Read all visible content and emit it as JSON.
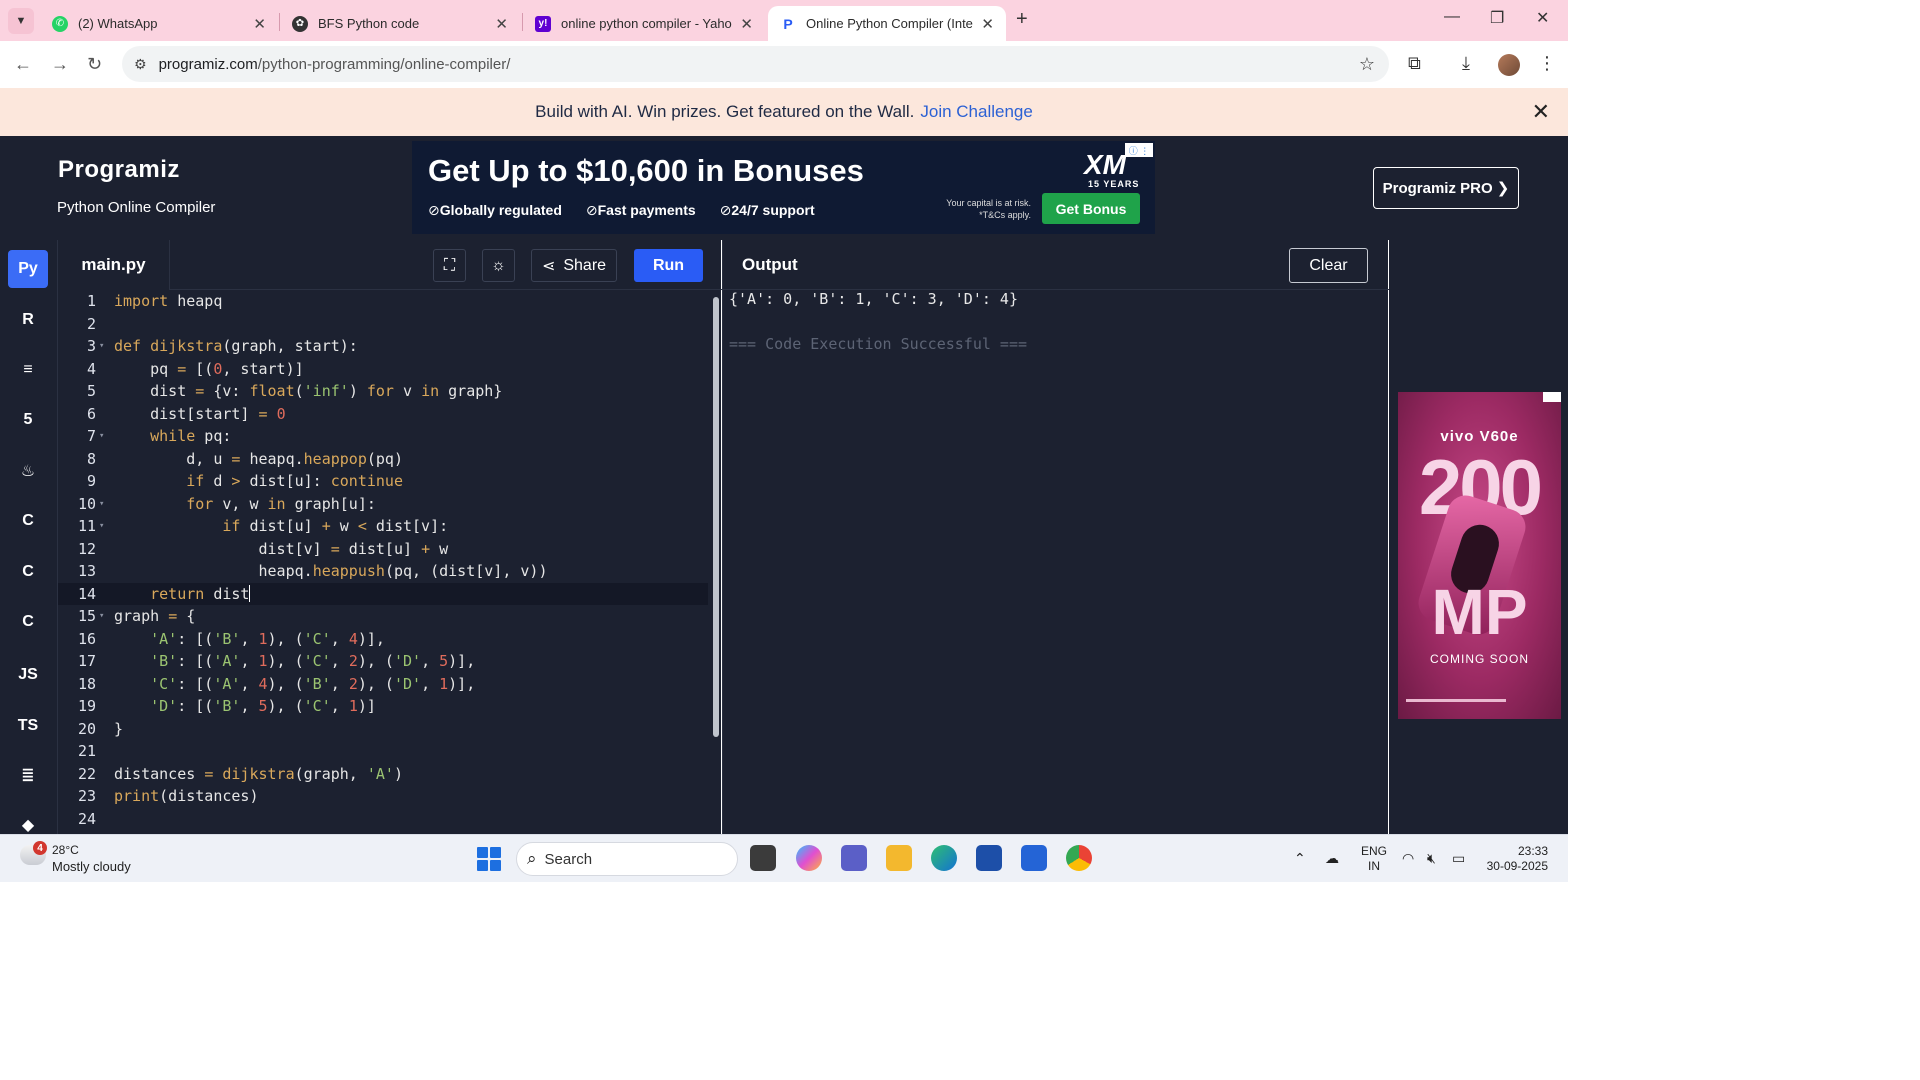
{
  "browser": {
    "tabs": [
      {
        "title": "(2) WhatsApp",
        "icon": "whatsapp-icon",
        "color": "#25d366"
      },
      {
        "title": "BFS Python code",
        "icon": "chatgpt-icon",
        "color": "#333333"
      },
      {
        "title": "online python compiler - Yahoo",
        "icon": "yahoo-icon",
        "color": "#5f01d1"
      },
      {
        "title": "Online Python Compiler (Interp",
        "icon": "programiz-icon",
        "color": "#2a5cf5"
      }
    ],
    "url_host": "programiz.com",
    "url_path": "/python-programming/online-compiler/"
  },
  "promo": {
    "text": "Build with AI. Win prizes. Get featured on the Wall.",
    "link": "Join Challenge"
  },
  "header": {
    "logo": "Programiz",
    "subtitle": "Python Online Compiler",
    "pro_button": "Programiz PRO ❯"
  },
  "ad": {
    "headline": "Get Up to $10,600 in Bonuses",
    "features": [
      "Globally regulated",
      "Fast payments",
      "24/7 support"
    ],
    "brand": "XM",
    "years": "15 YEARS",
    "risk_line1": "Your capital is at risk.",
    "risk_line2": "*T&Cs apply.",
    "cta": "Get Bonus"
  },
  "rail": {
    "items": [
      {
        "name": "python-icon",
        "glyph": "Py"
      },
      {
        "name": "r-icon",
        "glyph": "R"
      },
      {
        "name": "sql-icon",
        "glyph": "≡"
      },
      {
        "name": "html-icon",
        "glyph": "5"
      },
      {
        "name": "java-icon",
        "glyph": "♨"
      },
      {
        "name": "c-icon",
        "glyph": "C"
      },
      {
        "name": "cpp-icon",
        "glyph": "C"
      },
      {
        "name": "csharp-icon",
        "glyph": "C"
      },
      {
        "name": "js-icon",
        "glyph": "JS"
      },
      {
        "name": "ts-icon",
        "glyph": "TS"
      },
      {
        "name": "stack-icon",
        "glyph": "≣"
      },
      {
        "name": "more-icon",
        "glyph": "◆"
      }
    ]
  },
  "editor": {
    "file_tab": "main.py",
    "share_label": "Share",
    "run_label": "Run",
    "current_line": 14,
    "lines": [
      "import heapq",
      "",
      "def dijkstra(graph, start):",
      "    pq = [(0, start)]",
      "    dist = {v: float('inf') for v in graph}",
      "    dist[start] = 0",
      "    while pq:",
      "        d, u = heapq.heappop(pq)",
      "        if d > dist[u]: continue",
      "        for v, w in graph[u]:",
      "            if dist[u] + w < dist[v]:",
      "                dist[v] = dist[u] + w",
      "                heapq.heappush(pq, (dist[v], v))",
      "    return dist",
      "graph = {",
      "    'A': [('B', 1), ('C', 4)],",
      "    'B': [('A', 1), ('C', 2), ('D', 5)],",
      "    'C': [('A', 4), ('B', 2), ('D', 1)],",
      "    'D': [('B', 5), ('C', 1)]",
      "}",
      "",
      "distances = dijkstra(graph, 'A')",
      "print(distances)",
      ""
    ],
    "fold_lines": [
      3,
      7,
      10,
      11,
      15
    ]
  },
  "output": {
    "title": "Output",
    "clear_label": "Clear",
    "result": "{'A': 0, 'B': 1, 'C': 3, 'D': 4}",
    "status": "=== Code Execution Successful ==="
  },
  "side_ad": {
    "brand": "vivo V60e",
    "big": "200",
    "unit": "MP",
    "tag": "COMING SOON"
  },
  "taskbar": {
    "temp": "28°C",
    "weather": "Mostly cloudy",
    "weather_badge": "4",
    "search": "Search",
    "lang1": "ENG",
    "lang2": "IN",
    "time": "23:33",
    "date": "30-09-2025"
  }
}
